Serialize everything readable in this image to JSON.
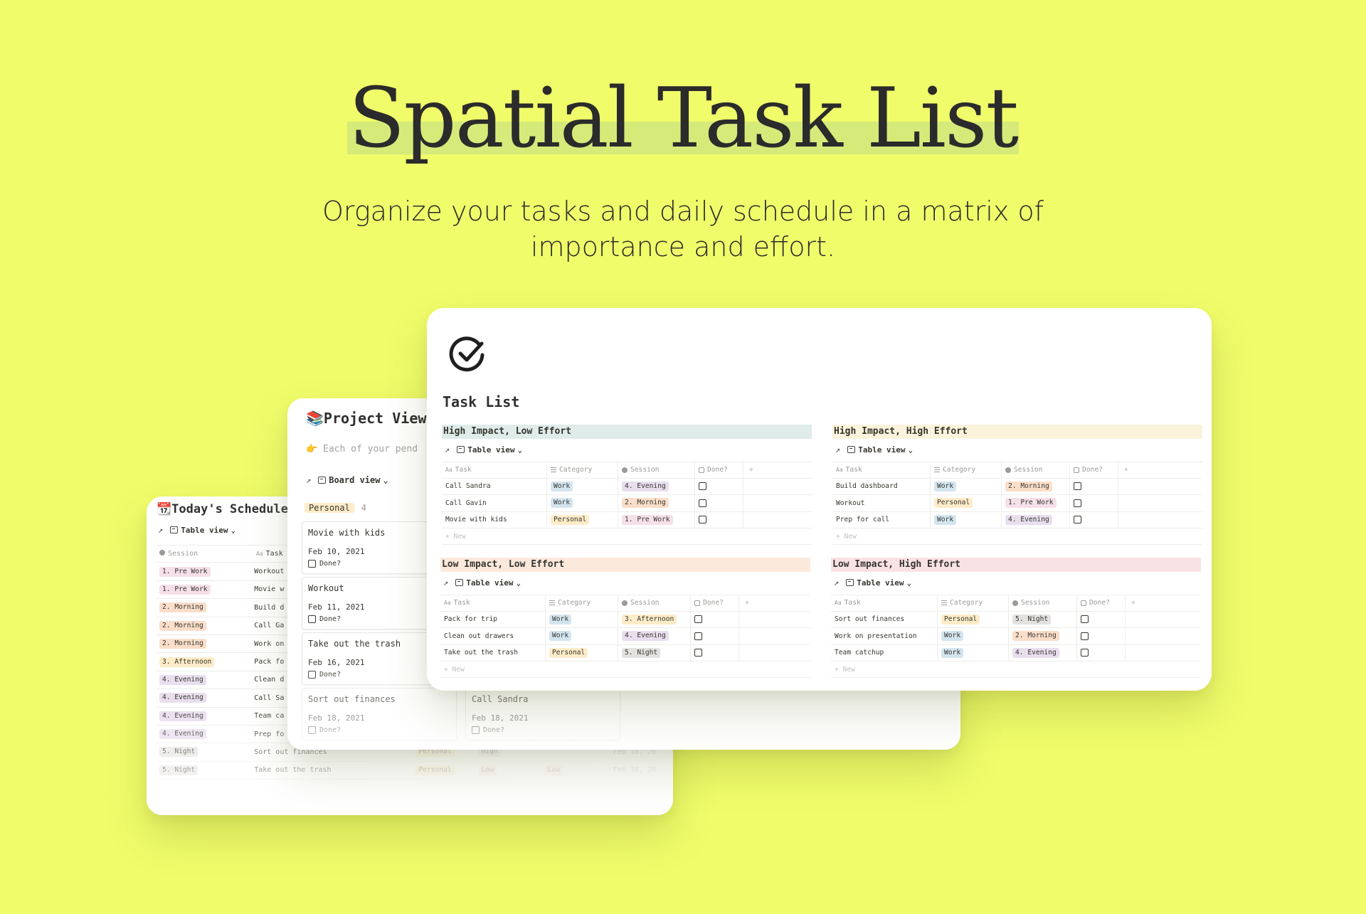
{
  "hero": {
    "title": "Spatial Task List",
    "subtitle": "Organize your tasks and daily schedule in a matrix of importance and effort."
  },
  "colors": {
    "background": "#f0fc6a",
    "title_highlight": "#d6ea7a",
    "tag_work": "#d3e5ef",
    "tag_personal": "#fdecc8",
    "tag_morning": "#fadec9",
    "tag_evening": "#e8deee",
    "tag_prework": "#f5e0e9",
    "tag_afternoon": "#fdecc8",
    "tag_night": "#e3e2e0",
    "tag_low": "#ffe2dd"
  },
  "schedule": {
    "icon": "📆",
    "title": "Today's Schedule",
    "view_label": "Table view",
    "headers": [
      "Session",
      "Task"
    ],
    "rows": [
      {
        "session": "1. Pre Work",
        "task": "Workout",
        "category": "",
        "impact": "",
        "effort": "",
        "date": ""
      },
      {
        "session": "1. Pre Work",
        "task": "Movie w",
        "category": "",
        "impact": "",
        "effort": "",
        "date": ""
      },
      {
        "session": "2. Morning",
        "task": "Build d",
        "category": "",
        "impact": "",
        "effort": "",
        "date": ""
      },
      {
        "session": "2. Morning",
        "task": "Call Ga",
        "category": "",
        "impact": "",
        "effort": "",
        "date": ""
      },
      {
        "session": "2. Morning",
        "task": "Work on",
        "category": "",
        "impact": "",
        "effort": "",
        "date": ""
      },
      {
        "session": "3. Afternoon",
        "task": "Pack fo",
        "category": "",
        "impact": "",
        "effort": "",
        "date": ""
      },
      {
        "session": "4. Evening",
        "task": "Clean d",
        "category": "",
        "impact": "",
        "effort": "",
        "date": ""
      },
      {
        "session": "4. Evening",
        "task": "Call Sa",
        "category": "",
        "impact": "",
        "effort": "",
        "date": ""
      },
      {
        "session": "4. Evening",
        "task": "Team ca",
        "category": "",
        "impact": "",
        "effort": "",
        "date": ""
      },
      {
        "session": "4. Evening",
        "task": "Prep fo",
        "category": "",
        "impact": "",
        "effort": "",
        "date": ""
      },
      {
        "session": "5. Night",
        "task": "Sort out finances",
        "category": "Personal",
        "impact": "High",
        "effort": "",
        "date": "Feb 18, 20"
      },
      {
        "session": "5. Night",
        "task": "Take out the trash",
        "category": "Personal",
        "impact": "Low",
        "effort": "Low",
        "date": "Feb 16, 20"
      }
    ]
  },
  "project": {
    "icon": "📚",
    "title": "Project View",
    "description_icon": "👉",
    "description": "Each of your pend",
    "view_label": "Board view",
    "group_label": "Personal",
    "group_count": "4",
    "cards_col1": [
      {
        "title": "Movie with kids",
        "date": "Feb 10, 2021",
        "done_label": "Done?"
      },
      {
        "title": "Workout",
        "date": "Feb 11, 2021",
        "done_label": "Done?"
      },
      {
        "title": "Take out the trash",
        "date": "Feb 16, 2021",
        "done_label": "Done?"
      },
      {
        "title": "Sort out finances",
        "date": "Feb 18, 2021",
        "done_label": "Done?"
      }
    ],
    "cards_col2": [
      {
        "title": "Call Sandra",
        "date": "Feb 18, 2021",
        "done_label": "Done?"
      }
    ]
  },
  "main": {
    "title": "Task List",
    "view_label": "Table view",
    "headers": {
      "task": "Task",
      "category": "Category",
      "session": "Session",
      "done": "Done?",
      "plus": "+"
    },
    "new_label": "+ New",
    "quadrants": [
      {
        "title": "High Impact, Low Effort",
        "color": "#dfece9",
        "rows": [
          {
            "task": "Call Sandra",
            "category": "Work",
            "session": "4. Evening"
          },
          {
            "task": "Call Gavin",
            "category": "Work",
            "session": "2. Morning"
          },
          {
            "task": "Movie with kids",
            "category": "Personal",
            "session": "1. Pre Work"
          }
        ]
      },
      {
        "title": "High Impact, High Effort",
        "color": "#fbf3dc",
        "rows": [
          {
            "task": "Build dashboard",
            "category": "Work",
            "session": "2. Morning"
          },
          {
            "task": "Workout",
            "category": "Personal",
            "session": "1. Pre Work"
          },
          {
            "task": "Prep for call",
            "category": "Work",
            "session": "4. Evening"
          }
        ]
      },
      {
        "title": "Low Impact, Low Effort",
        "color": "#fbe9dc",
        "rows": [
          {
            "task": "Pack for trip",
            "category": "Work",
            "session": "3. Afternoon"
          },
          {
            "task": "Clean out drawers",
            "category": "Work",
            "session": "4. Evening"
          },
          {
            "task": "Take out the trash",
            "category": "Personal",
            "session": "5. Night"
          }
        ]
      },
      {
        "title": "Low Impact, High Effort",
        "color": "#f9e2e4",
        "rows": [
          {
            "task": "Sort out finances",
            "category": "Personal",
            "session": "5. Night"
          },
          {
            "task": "Work on presentation",
            "category": "Work",
            "session": "2. Morning"
          },
          {
            "task": "Team catchup",
            "category": "Work",
            "session": "4. Evening"
          }
        ]
      }
    ]
  }
}
